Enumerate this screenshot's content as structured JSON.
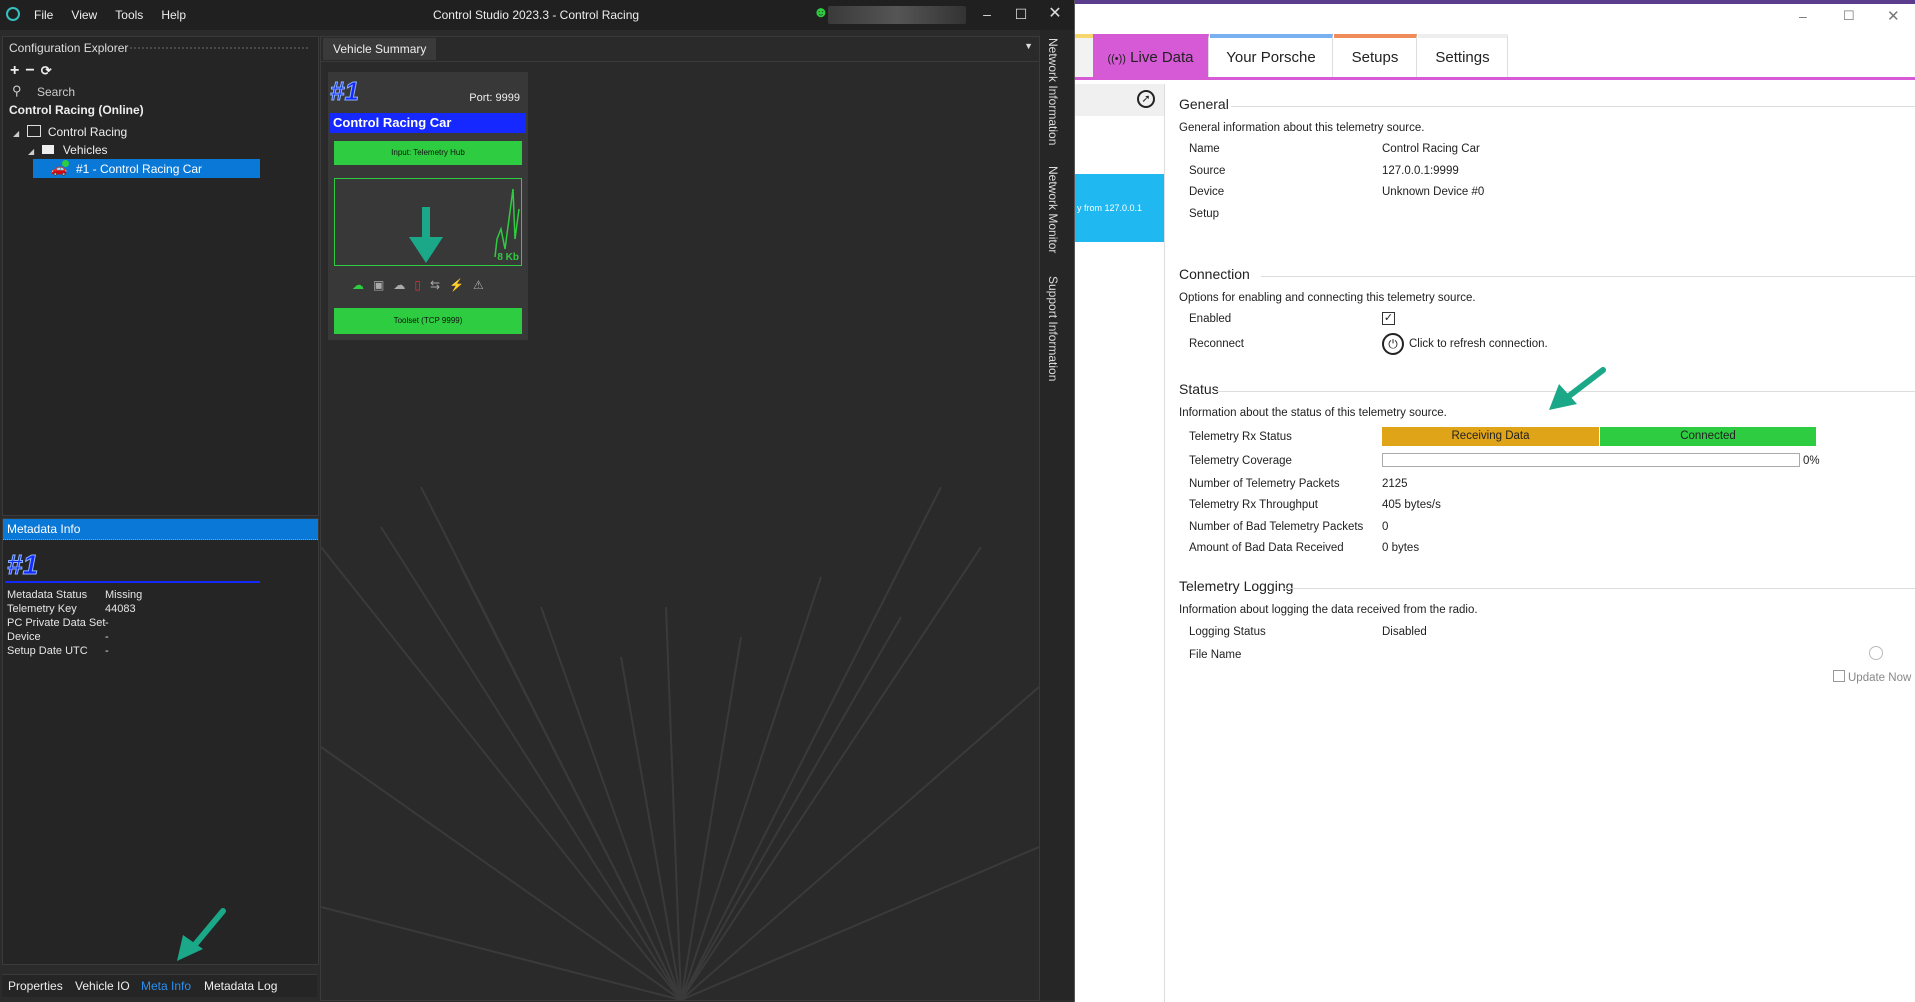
{
  "app": {
    "title": "Control Studio 2023.3 - Control Racing",
    "menu": [
      "File",
      "View",
      "Tools",
      "Help"
    ],
    "explorer": {
      "header": "Configuration Explorer",
      "search_placeholder": "Search",
      "online_label": "Control Racing (Online)",
      "tree": {
        "root": "Control Racing",
        "folder": "Vehicles",
        "vehicle": "#1 - Control Racing Car"
      }
    },
    "metadata": {
      "header": "Metadata Info",
      "car_number": "#1",
      "rows": [
        {
          "label": "Metadata Status",
          "value": "Missing"
        },
        {
          "label": "Telemetry Key",
          "value": "44083"
        },
        {
          "label": "PC Private Data Set",
          "value": "-"
        },
        {
          "label": "Device",
          "value": "-"
        },
        {
          "label": "Setup Date UTC",
          "value": "-"
        }
      ]
    },
    "bottom_tabs": [
      "Properties",
      "Vehicle IO",
      "Meta Info",
      "Metadata Log"
    ],
    "summary": {
      "tab": "Vehicle Summary",
      "card": {
        "number": "#1",
        "port": "Port: 9999",
        "name": "Control Racing Car",
        "input": "Input: Telemetry Hub",
        "rate": "8 Kb",
        "toolset": "Toolset (TCP 9999)"
      }
    },
    "side_tabs": [
      "Network Information",
      "Network Monitor",
      "Support Information"
    ]
  },
  "porsche": {
    "tabs": [
      "Live Data",
      "Your Porsche",
      "Setups",
      "Settings"
    ],
    "left_item_text": "y from 127.0.0.1",
    "general": {
      "title": "General",
      "desc": "General information about this telemetry source.",
      "rows": [
        {
          "label": "Name",
          "value": "Control Racing Car"
        },
        {
          "label": "Source",
          "value": "127.0.0.1:9999"
        },
        {
          "label": "Device",
          "value": "Unknown Device #0"
        },
        {
          "label": "Setup",
          "value": ""
        }
      ]
    },
    "connection": {
      "title": "Connection",
      "desc": "Options for enabling and connecting this telemetry source.",
      "enabled_label": "Enabled",
      "enabled": true,
      "reconnect_label": "Reconnect",
      "reconnect_text": "Click to refresh connection."
    },
    "status": {
      "title": "Status",
      "desc": "Information about the status of this telemetry source.",
      "rx_label": "Telemetry Rx Status",
      "rx_state": "Receiving Data",
      "conn_state": "Connected",
      "coverage_label": "Telemetry Coverage",
      "coverage_value": "0%",
      "coverage_fraction": 0,
      "rows": [
        {
          "label": "Number of Telemetry Packets",
          "value": "2125"
        },
        {
          "label": "Telemetry Rx Throughput",
          "value": "405 bytes/s"
        },
        {
          "label": "Number of Bad Telemetry Packets",
          "value": "0"
        },
        {
          "label": "Amount of Bad Data Received",
          "value": "0 bytes"
        }
      ]
    },
    "logging": {
      "title": "Telemetry Logging",
      "desc": "Information about logging the data received from the radio.",
      "status_label": "Logging Status",
      "status_value": "Disabled",
      "file_label": "File Name",
      "update_button": "Update Now"
    }
  },
  "colors": {
    "accent_blue": "#0a78d7",
    "card_blue": "#1428ff",
    "green": "#2ecc40",
    "amber": "#e0a419",
    "magenta": "#d65ad6",
    "arrow": "#1aa888"
  }
}
